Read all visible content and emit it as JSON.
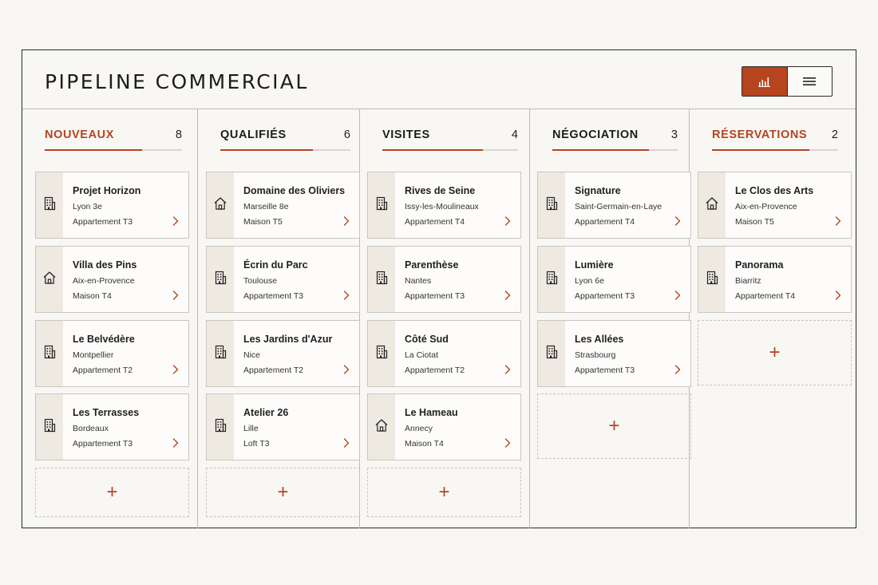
{
  "header": {
    "title": "PIPELINE COMMERCIAL"
  },
  "toggle": {
    "active": "chart-view",
    "icons": [
      "bar-chart-icon",
      "menu-icon"
    ]
  },
  "accent_color": "#b5441f",
  "columns": [
    {
      "title": "NOUVEAUX",
      "count": "8",
      "accent": true,
      "progress": 0.71,
      "cards": [
        {
          "name": "Projet Horizon",
          "city": "Lyon 3e",
          "type": "Appartement T3",
          "icon": "building-icon"
        },
        {
          "name": "Villa des Pins",
          "city": "Aix-en-Provence",
          "type": "Maison T4",
          "icon": "house-icon"
        },
        {
          "name": "Le Belvédère",
          "city": "Montpellier",
          "type": "Appartement T2",
          "icon": "building-icon"
        },
        {
          "name": "Les Terrasses",
          "city": "Bordeaux",
          "type": "Appartement T3",
          "icon": "building-icon"
        }
      ]
    },
    {
      "title": "QUALIFIÉS",
      "count": "6",
      "accent": false,
      "progress": 0.71,
      "cards": [
        {
          "name": "Domaine des Oliviers",
          "city": "Marseille 8e",
          "type": "Maison T5",
          "icon": "house-icon"
        },
        {
          "name": "Écrin du Parc",
          "city": "Toulouse",
          "type": "Appartement T3",
          "icon": "building-icon"
        },
        {
          "name": "Les Jardins d'Azur",
          "city": "Nice",
          "type": "Appartement T2",
          "icon": "building-icon"
        },
        {
          "name": "Atelier 26",
          "city": "Lille",
          "type": "Loft T3",
          "icon": "building-icon"
        }
      ]
    },
    {
      "title": "VISITES",
      "count": "4",
      "accent": false,
      "progress": 0.74,
      "cards": [
        {
          "name": "Rives de Seine",
          "city": "Issy-les-Moulineaux",
          "type": "Appartement T4",
          "icon": "building-icon"
        },
        {
          "name": "Parenthèse",
          "city": "Nantes",
          "type": "Appartement T3",
          "icon": "building-icon"
        },
        {
          "name": "Côté Sud",
          "city": "La Ciotat",
          "type": "Appartement T2",
          "icon": "building-icon"
        },
        {
          "name": "Le Hameau",
          "city": "Annecy",
          "type": "Maison T4",
          "icon": "house-icon"
        }
      ]
    },
    {
      "title": "NÉGOCIATION",
      "count": "3",
      "accent": false,
      "progress": 0.77,
      "cards": [
        {
          "name": "Signature",
          "city": "Saint-Germain-en-Laye",
          "type": "Appartement T4",
          "icon": "building-icon"
        },
        {
          "name": "Lumière",
          "city": "Lyon 6e",
          "type": "Appartement T3",
          "icon": "building-icon"
        },
        {
          "name": "Les Allées",
          "city": "Strasbourg",
          "type": "Appartement T3",
          "icon": "building-icon"
        }
      ]
    },
    {
      "title": "RÉSERVATIONS",
      "count": "2",
      "accent": true,
      "progress": 0.77,
      "cards": [
        {
          "name": "Le Clos des Arts",
          "city": "Aix-en-Provence",
          "type": "Maison T5",
          "icon": "house-icon"
        },
        {
          "name": "Panorama",
          "city": "Biarritz",
          "type": "Appartement T4",
          "icon": "building-icon"
        }
      ]
    }
  ],
  "add_label": "+"
}
